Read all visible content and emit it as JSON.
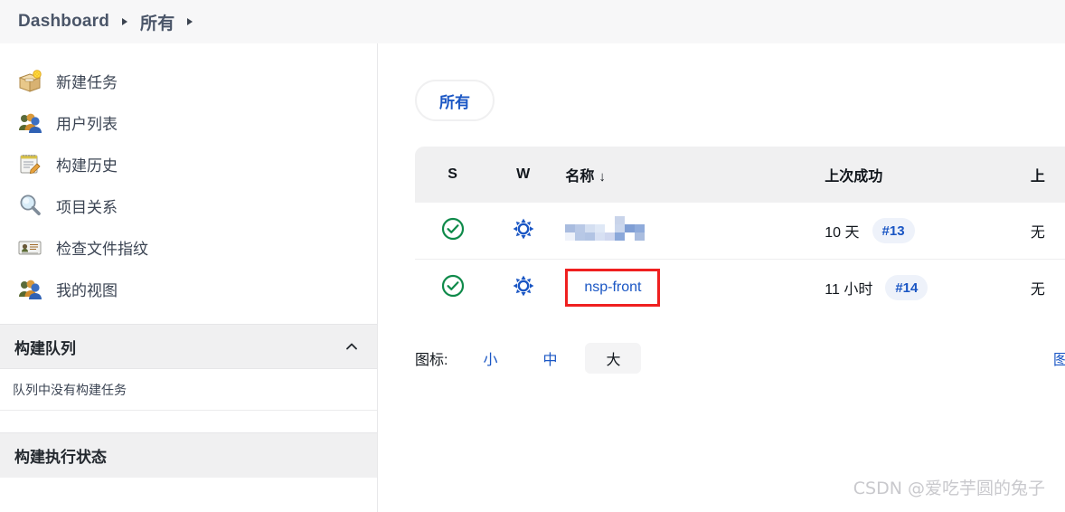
{
  "breadcrumb": {
    "items": [
      {
        "label": "Dashboard",
        "name": "breadcrumb-dashboard"
      },
      {
        "label": "所有",
        "name": "breadcrumb-all"
      }
    ]
  },
  "sidebar": {
    "items": [
      {
        "label": "新建任务",
        "icon": "new-job-box-icon"
      },
      {
        "label": "用户列表",
        "icon": "users-icon"
      },
      {
        "label": "构建历史",
        "icon": "build-history-notepad-icon"
      },
      {
        "label": "项目关系",
        "icon": "project-relationship-magnifier-icon"
      },
      {
        "label": "检查文件指纹",
        "icon": "fingerprint-card-icon"
      },
      {
        "label": "我的视图",
        "icon": "my-views-users-icon"
      }
    ],
    "queue": {
      "title": "构建队列",
      "empty_text": "队列中没有构建任务",
      "collapse_icon": "chevron-up-icon"
    },
    "executors": {
      "title": "构建执行状态"
    }
  },
  "main": {
    "tabs": [
      {
        "label": "所有",
        "selected": true
      }
    ],
    "table": {
      "headers": {
        "status": "S",
        "weather": "W",
        "name": "名称",
        "sort_arrow": "↓",
        "last_success": "上次成功",
        "last_failure": "上"
      },
      "rows": [
        {
          "status_icon": "success-check-icon",
          "weather_icon": "sunny-icon",
          "name": "",
          "name_blurred": true,
          "last_success": "10 天",
          "build_badge": "#13",
          "last_failure": "无",
          "highlighted": false
        },
        {
          "status_icon": "success-check-icon",
          "weather_icon": "sunny-icon",
          "name": "nsp-front",
          "name_blurred": false,
          "last_success": "11 小时",
          "build_badge": "#14",
          "last_failure": "无",
          "highlighted": true
        }
      ]
    },
    "icon_size": {
      "label": "图标:",
      "options": [
        {
          "label": "小",
          "selected": false
        },
        {
          "label": "中",
          "selected": false
        },
        {
          "label": "大",
          "selected": true
        }
      ],
      "legend_label": "图例"
    }
  },
  "watermark": {
    "text": "CSDN @爱吃芋圆的兔子"
  },
  "colors": {
    "accent_blue": "#1a56c4",
    "success_green": "#0f8a4a",
    "highlight_red": "#ef2020",
    "header_bg": "#f0f0f1",
    "topbar_bg": "#f7f7f8"
  }
}
